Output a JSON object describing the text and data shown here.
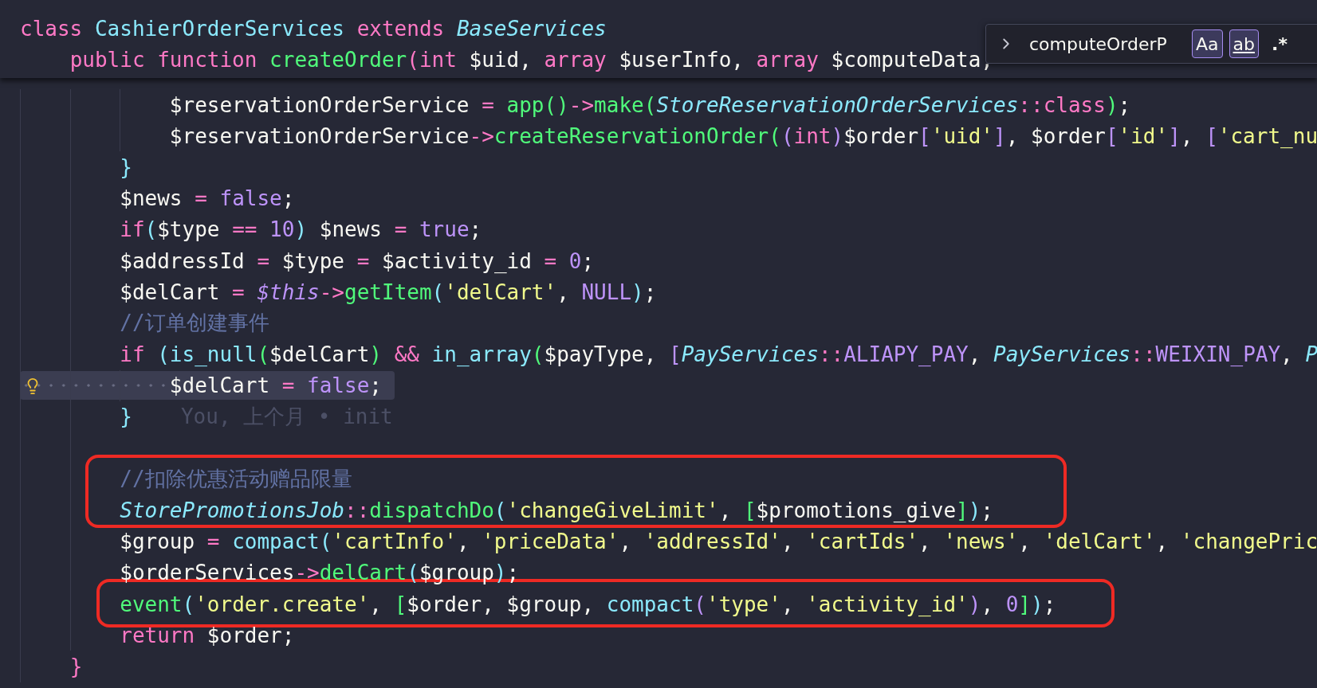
{
  "sticky_header": [
    {
      "tokens": [
        {
          "text": "class ",
          "kind": "keyword"
        },
        {
          "text": "CashierOrderServices",
          "kind": "type"
        },
        {
          "text": " extends ",
          "kind": "keyword"
        },
        {
          "text": "BaseServices",
          "kind": "class"
        }
      ]
    },
    {
      "tokens": [
        {
          "text": "    public function ",
          "kind": "keyword"
        },
        {
          "text": "createOrder",
          "kind": "function"
        },
        {
          "text": "(",
          "kind": "operator"
        },
        {
          "text": "int",
          "kind": "keyword"
        },
        {
          "text": " $uid, ",
          "kind": "variable"
        },
        {
          "text": "array",
          "kind": "keyword"
        },
        {
          "text": " $userInfo, ",
          "kind": "variable"
        },
        {
          "text": "array",
          "kind": "keyword"
        },
        {
          "text": " $computeData,",
          "kind": "variable"
        }
      ]
    }
  ],
  "find_widget": {
    "value": "computeOrderP",
    "toggles": [
      {
        "label": "Aa",
        "kind": "case",
        "selected": true
      },
      {
        "label": "ab",
        "kind": "word",
        "selected": true
      },
      {
        "label": ".*",
        "kind": "regex",
        "selected": false
      }
    ]
  },
  "lines": [
    {
      "selected": false,
      "tokens": [
        {
          "text": "            $reservationOrderService",
          "kind": "variable"
        },
        {
          "text": " = ",
          "kind": "operator"
        },
        {
          "text": "app()",
          "kind": "function"
        },
        {
          "text": "->",
          "kind": "operator"
        },
        {
          "text": "make(",
          "kind": "function"
        },
        {
          "text": "StoreReservationOrderServices",
          "kind": "class"
        },
        {
          "text": "::class",
          "kind": "operator"
        },
        {
          "text": ")",
          "kind": "function"
        },
        {
          "text": ";",
          "kind": "variable"
        }
      ]
    },
    {
      "selected": false,
      "tokens": [
        {
          "text": "            $reservationOrderService",
          "kind": "variable"
        },
        {
          "text": "->",
          "kind": "operator"
        },
        {
          "text": "createReservationOrder(",
          "kind": "function"
        },
        {
          "text": "(",
          "kind": "bracket1"
        },
        {
          "text": "int",
          "kind": "keyword"
        },
        {
          "text": ")",
          "kind": "bracket1"
        },
        {
          "text": "$order",
          "kind": "variable"
        },
        {
          "text": "[",
          "kind": "bracket1"
        },
        {
          "text": "'uid'",
          "kind": "string"
        },
        {
          "text": "]",
          "kind": "bracket1"
        },
        {
          "text": ", $order",
          "kind": "variable"
        },
        {
          "text": "[",
          "kind": "bracket1"
        },
        {
          "text": "'id'",
          "kind": "string"
        },
        {
          "text": "]",
          "kind": "bracket1"
        },
        {
          "text": ", ",
          "kind": "variable"
        },
        {
          "text": "[",
          "kind": "bracket1"
        },
        {
          "text": "'cart_nu",
          "kind": "string"
        }
      ]
    },
    {
      "selected": false,
      "tokens": [
        {
          "text": "        }",
          "kind": "bracket2"
        }
      ]
    },
    {
      "selected": false,
      "tokens": [
        {
          "text": "        $news",
          "kind": "variable"
        },
        {
          "text": " = ",
          "kind": "operator"
        },
        {
          "text": "false",
          "kind": "constant"
        },
        {
          "text": ";",
          "kind": "variable"
        }
      ]
    },
    {
      "selected": false,
      "tokens": [
        {
          "text": "        if",
          "kind": "keyword"
        },
        {
          "text": "(",
          "kind": "bracket2"
        },
        {
          "text": "$type",
          "kind": "variable"
        },
        {
          "text": " == ",
          "kind": "operator"
        },
        {
          "text": "10",
          "kind": "constant"
        },
        {
          "text": ")",
          "kind": "bracket2"
        },
        {
          "text": " $news",
          "kind": "variable"
        },
        {
          "text": " = ",
          "kind": "operator"
        },
        {
          "text": "true",
          "kind": "constant"
        },
        {
          "text": ";",
          "kind": "variable"
        }
      ]
    },
    {
      "selected": false,
      "tokens": [
        {
          "text": "        $addressId",
          "kind": "variable"
        },
        {
          "text": " = ",
          "kind": "operator"
        },
        {
          "text": "$type",
          "kind": "variable"
        },
        {
          "text": " = ",
          "kind": "operator"
        },
        {
          "text": "$activity_id",
          "kind": "variable"
        },
        {
          "text": " = ",
          "kind": "operator"
        },
        {
          "text": "0",
          "kind": "constant"
        },
        {
          "text": ";",
          "kind": "variable"
        }
      ]
    },
    {
      "selected": false,
      "tokens": [
        {
          "text": "        $delCart",
          "kind": "variable"
        },
        {
          "text": " = ",
          "kind": "operator"
        },
        {
          "text": "$this",
          "kind": "this"
        },
        {
          "text": "->",
          "kind": "operator"
        },
        {
          "text": "getItem",
          "kind": "function"
        },
        {
          "text": "(",
          "kind": "bracket2"
        },
        {
          "text": "'delCart'",
          "kind": "string"
        },
        {
          "text": ", ",
          "kind": "variable"
        },
        {
          "text": "NULL",
          "kind": "constant"
        },
        {
          "text": ")",
          "kind": "bracket2"
        },
        {
          "text": ";",
          "kind": "variable"
        }
      ]
    },
    {
      "selected": false,
      "tokens": [
        {
          "text": "        //订单创建事件",
          "kind": "comment"
        }
      ]
    },
    {
      "selected": false,
      "tokens": [
        {
          "text": "        if ",
          "kind": "keyword"
        },
        {
          "text": "(",
          "kind": "bracket2"
        },
        {
          "text": "is_null",
          "kind": "builtin"
        },
        {
          "text": "(",
          "kind": "bracket3"
        },
        {
          "text": "$delCart",
          "kind": "variable"
        },
        {
          "text": ")",
          "kind": "bracket3"
        },
        {
          "text": " && ",
          "kind": "operator"
        },
        {
          "text": "in_array",
          "kind": "builtin"
        },
        {
          "text": "(",
          "kind": "bracket3"
        },
        {
          "text": "$payType, ",
          "kind": "variable"
        },
        {
          "text": "[",
          "kind": "bracket1"
        },
        {
          "text": "PayServices",
          "kind": "class"
        },
        {
          "text": "::",
          "kind": "operator"
        },
        {
          "text": "ALIAPY_PAY",
          "kind": "constant"
        },
        {
          "text": ", ",
          "kind": "variable"
        },
        {
          "text": "PayServices",
          "kind": "class"
        },
        {
          "text": "::",
          "kind": "operator"
        },
        {
          "text": "WEIXIN_PAY",
          "kind": "constant"
        },
        {
          "text": ", ",
          "kind": "variable"
        },
        {
          "text": "P",
          "kind": "class"
        }
      ]
    },
    {
      "selected": true,
      "tokens": [
        {
          "text": "            $delCart",
          "kind": "variable"
        },
        {
          "text": " = ",
          "kind": "operator"
        },
        {
          "text": "false",
          "kind": "constant"
        },
        {
          "text": ";",
          "kind": "variable"
        }
      ]
    },
    {
      "selected": false,
      "blame": "You, 上个月 • init",
      "tokens": [
        {
          "text": "        }",
          "kind": "bracket2"
        }
      ]
    },
    {
      "selected": false
    },
    {
      "selected": false,
      "tokens": [
        {
          "text": "        //扣除优惠活动赠品限量",
          "kind": "comment"
        }
      ]
    },
    {
      "selected": false,
      "tokens": [
        {
          "text": "        StorePromotionsJob",
          "kind": "class"
        },
        {
          "text": "::",
          "kind": "operator"
        },
        {
          "text": "dispatchDo",
          "kind": "function"
        },
        {
          "text": "(",
          "kind": "bracket2"
        },
        {
          "text": "'changeGiveLimit'",
          "kind": "string"
        },
        {
          "text": ", ",
          "kind": "variable"
        },
        {
          "text": "[",
          "kind": "bracket3"
        },
        {
          "text": "$promotions_give",
          "kind": "variable"
        },
        {
          "text": "]",
          "kind": "bracket3"
        },
        {
          "text": ")",
          "kind": "bracket2"
        },
        {
          "text": ";",
          "kind": "variable"
        }
      ]
    },
    {
      "selected": false,
      "tokens": [
        {
          "text": "        $group",
          "kind": "variable"
        },
        {
          "text": " = ",
          "kind": "operator"
        },
        {
          "text": "compact",
          "kind": "builtin"
        },
        {
          "text": "(",
          "kind": "bracket2"
        },
        {
          "text": "'cartInfo'",
          "kind": "string"
        },
        {
          "text": ", ",
          "kind": "variable"
        },
        {
          "text": "'priceData'",
          "kind": "string"
        },
        {
          "text": ", ",
          "kind": "variable"
        },
        {
          "text": "'addressId'",
          "kind": "string"
        },
        {
          "text": ", ",
          "kind": "variable"
        },
        {
          "text": "'cartIds'",
          "kind": "string"
        },
        {
          "text": ", ",
          "kind": "variable"
        },
        {
          "text": "'news'",
          "kind": "string"
        },
        {
          "text": ", ",
          "kind": "variable"
        },
        {
          "text": "'delCart'",
          "kind": "string"
        },
        {
          "text": ", ",
          "kind": "variable"
        },
        {
          "text": "'changePric",
          "kind": "string"
        }
      ]
    },
    {
      "selected": false,
      "tokens": [
        {
          "text": "        $orderServices",
          "kind": "variable"
        },
        {
          "text": "->",
          "kind": "operator"
        },
        {
          "text": "delCart",
          "kind": "function"
        },
        {
          "text": "(",
          "kind": "bracket2"
        },
        {
          "text": "$group",
          "kind": "variable"
        },
        {
          "text": ")",
          "kind": "bracket2"
        },
        {
          "text": ";",
          "kind": "variable"
        }
      ]
    },
    {
      "selected": false,
      "tokens": [
        {
          "text": "        event",
          "kind": "function"
        },
        {
          "text": "(",
          "kind": "bracket2"
        },
        {
          "text": "'order.create'",
          "kind": "string"
        },
        {
          "text": ", ",
          "kind": "variable"
        },
        {
          "text": "[",
          "kind": "bracket3"
        },
        {
          "text": "$order, $group, ",
          "kind": "variable"
        },
        {
          "text": "compact",
          "kind": "builtin"
        },
        {
          "text": "(",
          "kind": "bracket1"
        },
        {
          "text": "'type'",
          "kind": "string"
        },
        {
          "text": ", ",
          "kind": "variable"
        },
        {
          "text": "'activity_id'",
          "kind": "string"
        },
        {
          "text": ")",
          "kind": "bracket1"
        },
        {
          "text": ", ",
          "kind": "variable"
        },
        {
          "text": "0",
          "kind": "constant"
        },
        {
          "text": "]",
          "kind": "bracket3"
        },
        {
          "text": ")",
          "kind": "bracket2"
        },
        {
          "text": ";",
          "kind": "variable"
        }
      ]
    },
    {
      "selected": false,
      "tokens": [
        {
          "text": "        return",
          "kind": "keyword"
        },
        {
          "text": " $order;",
          "kind": "variable"
        }
      ]
    },
    {
      "selected": false,
      "tokens": [
        {
          "text": "    }",
          "kind": "bracket4"
        }
      ]
    }
  ]
}
